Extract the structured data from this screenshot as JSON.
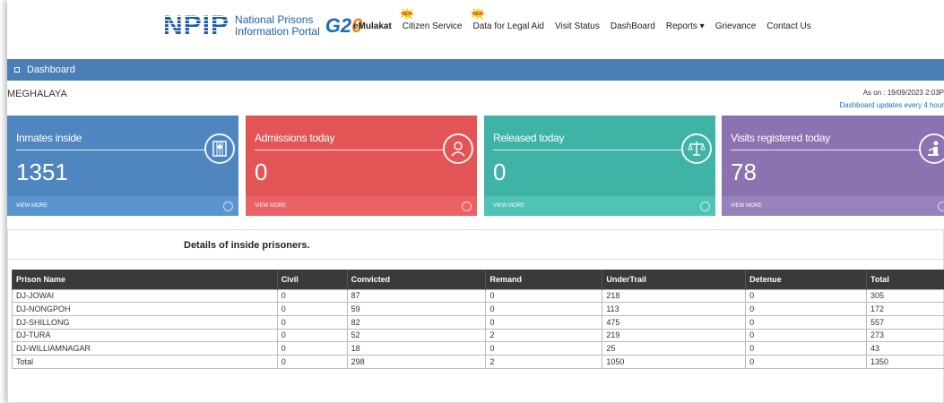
{
  "header": {
    "logo_text": "NPIP",
    "logo_line1": "National Prisons",
    "logo_line2": "Information Portal",
    "g20_text": "G2",
    "g20_o": "0",
    "nav": [
      {
        "label": "eMulakat",
        "new": false
      },
      {
        "label": "Citizen Service",
        "new": true
      },
      {
        "label": "Data for Legal Aid",
        "new": true
      },
      {
        "label": "Visit Status",
        "new": false
      },
      {
        "label": "DashBoard",
        "new": false
      },
      {
        "label": "Reports ▾",
        "new": false
      },
      {
        "label": "Grievance",
        "new": false
      },
      {
        "label": "Contact Us",
        "new": false
      }
    ],
    "new_badge_text": "NEW"
  },
  "dashboard_bar": {
    "title": "Dashboard"
  },
  "state": "MEGHALAYA",
  "as_on": "As on : 19/09/2023 2:03P",
  "updates_note": "Dashboard updates every 4 hour",
  "cards": [
    {
      "title": "Inmates inside",
      "value": "1351",
      "more": "VIEW MORE",
      "icon": "inmates-icon",
      "color": "#4f86c0",
      "foot": "#5b95cf"
    },
    {
      "title": "Admissions today",
      "value": "0",
      "more": "VIEW MORE",
      "icon": "admission-icon",
      "color": "#e25455",
      "foot": "#ea6264"
    },
    {
      "title": "Released today",
      "value": "0",
      "more": "VIEW MORE",
      "icon": "scales-icon",
      "color": "#3fb3a6",
      "foot": "#4fc3b6"
    },
    {
      "title": "Visits registered today",
      "value": "78",
      "more": "VIEW MORE",
      "icon": "visitor-icon",
      "color": "#8a73b0",
      "foot": "#9782bc"
    }
  ],
  "details": {
    "title": "Details of inside prisoners.",
    "columns": [
      "Prison Name",
      "Civil",
      "Convicted",
      "Remand",
      "UnderTrail",
      "Detenue",
      "Total"
    ],
    "rows": [
      [
        "DJ-JOWAI",
        "0",
        "87",
        "0",
        "218",
        "0",
        "305"
      ],
      [
        "DJ-NONGPOH",
        "0",
        "59",
        "0",
        "113",
        "0",
        "172"
      ],
      [
        "DJ-SHILLONG",
        "0",
        "82",
        "0",
        "475",
        "0",
        "557"
      ],
      [
        "DJ-TURA",
        "0",
        "52",
        "2",
        "219",
        "0",
        "273"
      ],
      [
        "DJ-WILLIAMNAGAR",
        "0",
        "18",
        "0",
        "25",
        "0",
        "43"
      ],
      [
        "Total",
        "0",
        "298",
        "2",
        "1050",
        "0",
        "1350"
      ]
    ]
  }
}
